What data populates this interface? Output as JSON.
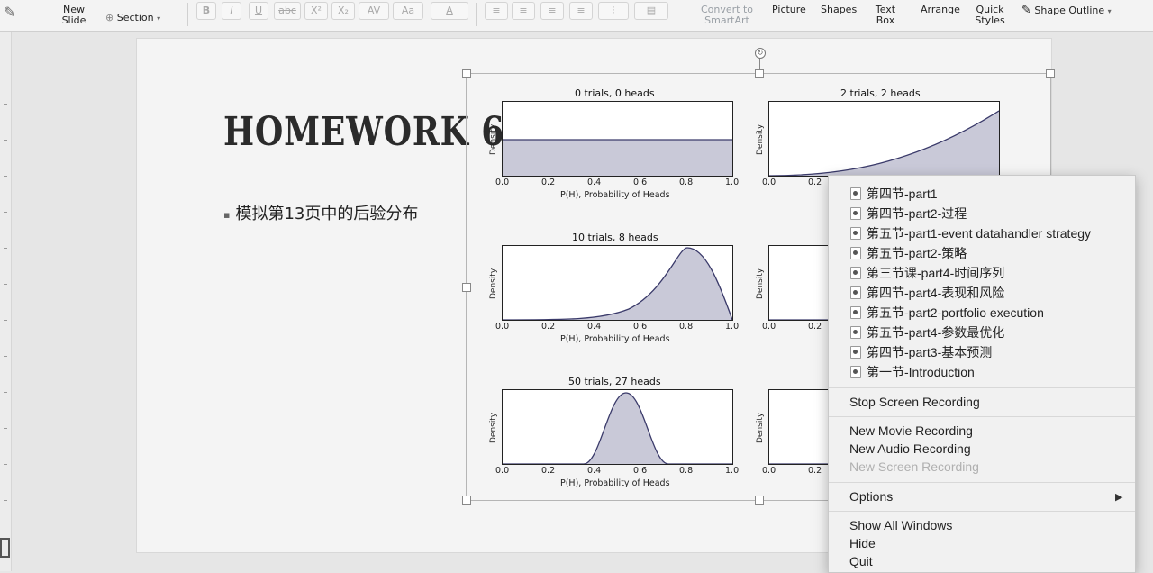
{
  "ribbon": {
    "new_slide": "New\nSlide",
    "section": "Section",
    "format_buttons": [
      "B",
      "I",
      "U",
      "abc",
      "X²",
      "X₂",
      "AV",
      "Aa",
      "A"
    ],
    "convert_to_smartart": "Convert to\nSmartArt",
    "picture": "Picture",
    "shapes": "Shapes",
    "text_box": "Text\nBox",
    "arrange": "Arrange",
    "quick_styles": "Quick\nStyles",
    "shape_outline": "Shape Outline"
  },
  "slide": {
    "title": "HOMEWORK 6",
    "bullet": "模拟第13页中的后验分布"
  },
  "plots": [
    {
      "title": "0 trials, 0 heads",
      "ylabel": "Density",
      "xlabel": "P(H), Probability of Heads",
      "xticks": [
        "0.0",
        "0.2",
        "0.4",
        "0.6",
        "0.8",
        "1.0"
      ]
    },
    {
      "title": "2 trials, 2 heads",
      "ylabel": "Density",
      "xticks": [
        "0.0",
        "0.2"
      ]
    },
    {
      "title": "10 trials, 8 heads",
      "ylabel": "Density",
      "xlabel": "P(H), Probability of Heads",
      "xticks": [
        "0.0",
        "0.2",
        "0.4",
        "0.6",
        "0.8",
        "1.0"
      ]
    },
    {
      "title": "",
      "ylabel": "Density",
      "xticks": [
        "0.0",
        "0.2"
      ]
    },
    {
      "title": "50 trials, 27 heads",
      "ylabel": "Density",
      "xlabel": "P(H), Probability of Heads",
      "xticks": [
        "0.0",
        "0.2",
        "0.4",
        "0.6",
        "0.8",
        "1.0"
      ]
    },
    {
      "title": "",
      "ylabel": "Density",
      "xticks": [
        "0.0",
        "0.2"
      ]
    }
  ],
  "menu": {
    "recent_files": [
      "第四节-part1",
      "第四节-part2-过程",
      "第五节-part1-event datahandler strategy",
      "第五节-part2-策略",
      "第三节课-part4-时间序列",
      "第四节-part4-表现和风险",
      "第五节-part2-portfolio execution",
      "第五节-part4-参数最优化",
      "第四节-part3-基本预测",
      "第一节-Introduction"
    ],
    "stop_screen_recording": "Stop Screen Recording",
    "new_movie_recording": "New Movie Recording",
    "new_audio_recording": "New Audio Recording",
    "new_screen_recording": "New Screen Recording",
    "options": "Options",
    "show_all_windows": "Show All Windows",
    "hide": "Hide",
    "quit": "Quit"
  }
}
